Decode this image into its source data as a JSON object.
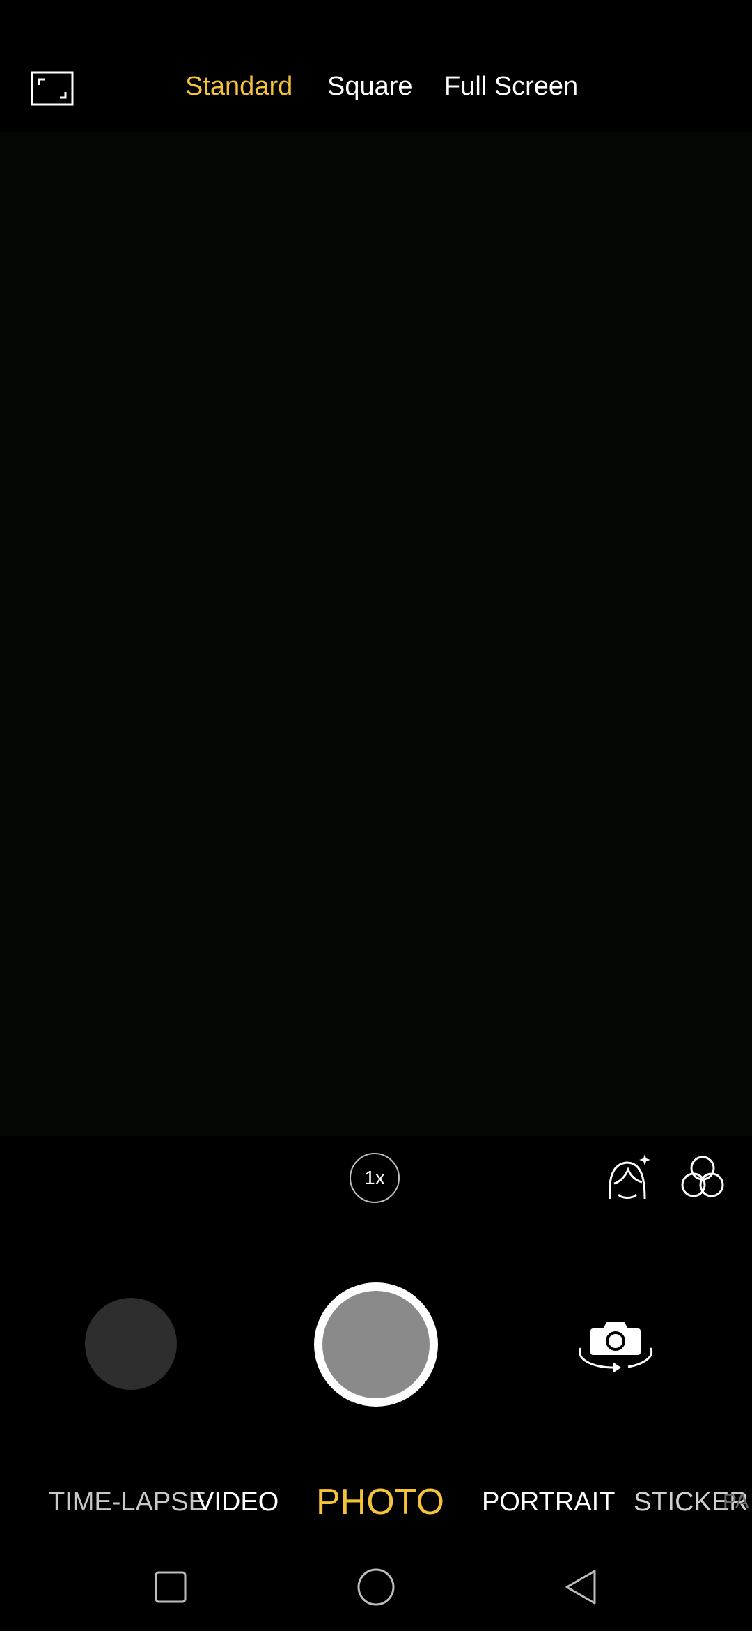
{
  "aspect_ratio": {
    "tabs": [
      {
        "label": "Standard",
        "active": true
      },
      {
        "label": "Square",
        "active": false
      },
      {
        "label": "Full Screen",
        "active": false
      }
    ],
    "active_color": "#F5C23A"
  },
  "controls": {
    "zoom_label": "1x"
  },
  "modes": {
    "items": [
      {
        "label": "TIME-LAPSE"
      },
      {
        "label": "VIDEO"
      },
      {
        "label": "PHOTO",
        "active": true
      },
      {
        "label": "PORTRAIT"
      },
      {
        "label": "STICKER"
      },
      {
        "label": "PA"
      }
    ]
  },
  "icons": {
    "aspect": "aspect-ratio-icon",
    "beauty": "beauty-face-icon",
    "filter": "filter-icon",
    "flip": "switch-camera-icon",
    "nav_recent": "square-icon",
    "nav_home": "circle-icon",
    "nav_back": "triangle-back-icon"
  }
}
